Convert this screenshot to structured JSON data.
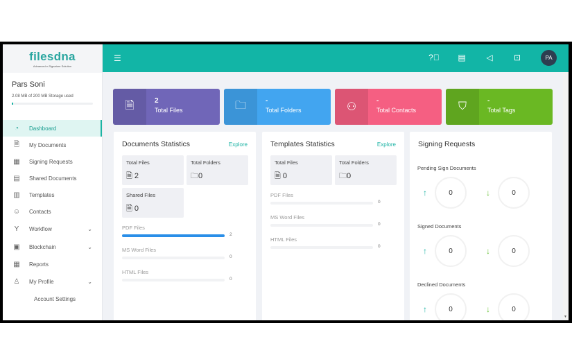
{
  "logo": {
    "name": "filesdna",
    "tagline": "Advanced e-Signature Solution"
  },
  "user": {
    "name": "Pars Soni",
    "storage": "2.08 MB of 200 MB Storage used",
    "storage_fraction": 0.0104
  },
  "nav": [
    {
      "label": "Dashboard",
      "icon": "dashboard-icon",
      "active": true
    },
    {
      "label": "My Documents",
      "icon": "document-icon"
    },
    {
      "label": "Signing Requests",
      "icon": "signing-icon"
    },
    {
      "label": "Shared Documents",
      "icon": "shared-icon"
    },
    {
      "label": "Templates",
      "icon": "template-icon"
    },
    {
      "label": "Contacts",
      "icon": "contacts-icon"
    },
    {
      "label": "Workflow",
      "icon": "workflow-icon",
      "expandable": true
    },
    {
      "label": "Blockchain",
      "icon": "blockchain-icon",
      "expandable": true
    },
    {
      "label": "Reports",
      "icon": "reports-icon"
    },
    {
      "label": "My Profile",
      "icon": "profile-icon",
      "expandable": true
    }
  ],
  "nav_sub": [
    "Account Settings"
  ],
  "header": {
    "avatar": "PA",
    "icons": [
      "help-icon",
      "document-search-icon",
      "announcement-icon",
      "translate-icon"
    ]
  },
  "cards": [
    {
      "value": "2",
      "label": "Total Files",
      "color": "#7066b8"
    },
    {
      "value": "-",
      "label": "Total Folders",
      "color": "#42a5f0"
    },
    {
      "value": "-",
      "label": "Total Contacts",
      "color": "#f55f82"
    },
    {
      "value": "-",
      "label": "Total Tags",
      "color": "#6ab823"
    }
  ],
  "documents": {
    "title": "Documents Statistics",
    "explore": "Explore",
    "total_files_label": "Total Files",
    "total_files": "2",
    "total_folders_label": "Total Folders",
    "total_folders": "0",
    "shared_label": "Shared Files",
    "shared": "0",
    "bars": [
      {
        "label": "PDF Files",
        "value": "2",
        "fraction": 1
      },
      {
        "label": "MS Word Files",
        "value": "0",
        "fraction": 0
      },
      {
        "label": "HTML Files",
        "value": "0",
        "fraction": 0
      }
    ]
  },
  "templates": {
    "title": "Templates Statistics",
    "explore": "Explore",
    "total_files_label": "Total Files",
    "total_files": "0",
    "total_folders_label": "Total Folders",
    "total_folders": "0",
    "bars": [
      {
        "label": "PDF Files",
        "value": "0",
        "fraction": 0
      },
      {
        "label": "MS Word Files",
        "value": "0",
        "fraction": 0
      },
      {
        "label": "HTML Files",
        "value": "0",
        "fraction": 0
      }
    ]
  },
  "signing": {
    "title": "Signing Requests",
    "groups": [
      {
        "label": "Pending Sign Documents",
        "up": "0",
        "down": "0"
      },
      {
        "label": "Signed Documents",
        "up": "0",
        "down": "0"
      },
      {
        "label": "Declined Documents",
        "up": "0",
        "down": "0"
      }
    ]
  }
}
